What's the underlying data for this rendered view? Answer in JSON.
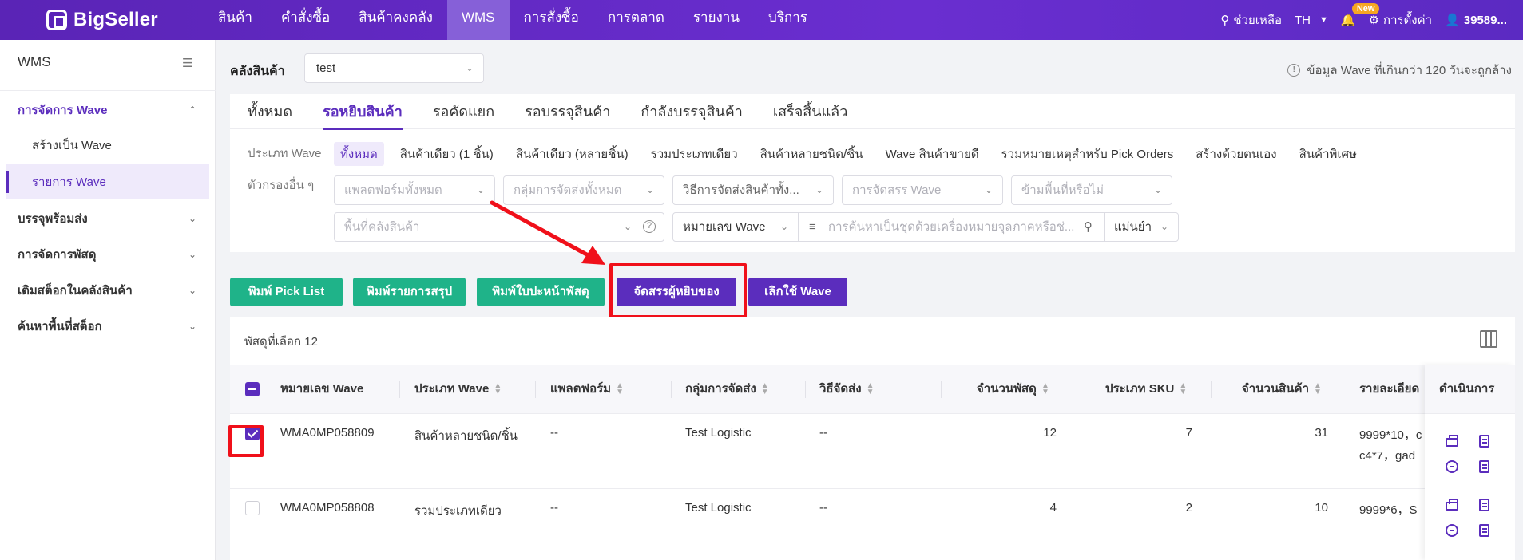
{
  "brand": {
    "name": "BigSeller"
  },
  "topnav": {
    "items": [
      "สินค้า",
      "คำสั่งซื้อ",
      "สินค้าคงคลัง",
      "WMS",
      "การสั่งซื้อ",
      "การตลาด",
      "รายงาน",
      "บริการ"
    ],
    "active_index": 3,
    "help": "ช่วยเหลือ",
    "lang": "TH",
    "new_badge": "New",
    "settings": "การตั้งค่า",
    "user": "39589..."
  },
  "sidebar": {
    "title": "WMS",
    "groups": [
      {
        "label": "การจัดการ Wave",
        "open": true
      },
      {
        "label": "บรรจุพร้อมส่ง"
      },
      {
        "label": "การจัดการพัสดุ"
      },
      {
        "label": "เติมสต็อกในคลังสินค้า"
      },
      {
        "label": "ค้นหาพื้นที่สต็อก"
      }
    ],
    "subitems": [
      "สร้างเป็น Wave",
      "รายการ Wave"
    ]
  },
  "warehouse": {
    "label": "คลังสินค้า",
    "value": "test",
    "notice": "ข้อมูล Wave ที่เกินกว่า 120 วันจะถูกล้าง"
  },
  "tabs": [
    "ทั้งหมด",
    "รอหยิบสินค้า",
    "รอคัดแยก",
    "รอบรรจุสินค้า",
    "กำลังบรรจุสินค้า",
    "เสร็จสิ้นแล้ว"
  ],
  "filters": {
    "wave_type_label": "ประเภท Wave",
    "wave_types": [
      "ทั้งหมด",
      "สินค้าเดียว (1 ชิ้น)",
      "สินค้าเดียว (หลายชิ้น)",
      "รวมประเภทเดียว",
      "สินค้าหลายชนิด/ชิ้น",
      "Wave สินค้าขายดี",
      "รวมหมายเหตุสำหรับ Pick Orders",
      "สร้างด้วยตนเอง",
      "สินค้าพิเศษ"
    ],
    "other_label": "ตัวกรองอื่น ๆ",
    "platform_ph": "แพลตฟอร์มทั้งหมด",
    "shipping_group_ph": "กลุ่มการจัดส่งทั้งหมด",
    "shipping_method_ph": "วิธีการจัดส่งสินค้าทั้ง...",
    "allocate_ph": "การจัดสรร Wave",
    "skip_area_ph": "ข้ามพื้นที่หรือไม่",
    "area_ph": "พื้นที่คลังสินค้า",
    "search_field": "หมายเลข Wave",
    "search_ph": "การค้นหาเป็นชุดด้วยเครื่องหมายจุลภาคหรือช่...",
    "match_mode": "แม่นยำ"
  },
  "actions": {
    "print_pick_list": "พิมพ์ Pick List",
    "print_summary": "พิมพ์รายการสรุป",
    "print_cover": "พิมพ์ใบปะหน้าพัสดุ",
    "assign_picker": "จัดสรรผู้หยิบของ",
    "cancel_wave": "เลิกใช้ Wave"
  },
  "table": {
    "selected_text": "พัสดุที่เลือก 12",
    "headers": {
      "wave_no": "หมายเลข Wave",
      "wave_type": "ประเภท Wave",
      "platform": "แพลตฟอร์ม",
      "shipping_group": "กลุ่มการจัดส่ง",
      "shipping_method": "วิธีจัดส่ง",
      "parcels": "จำนวนพัสดุ",
      "sku_types": "ประเภท SKU",
      "qty": "จำนวนสินค้า",
      "detail": "รายละเอียด",
      "ops": "ดำเนินการ"
    },
    "rows": [
      {
        "wave_no": "WMA0MP058809",
        "wave_type": "สินค้าหลายชนิด/ชิ้น",
        "platform": "--",
        "shipping_group": "Test Logistic",
        "shipping_method": "--",
        "parcels": "12",
        "sku_types": "7",
        "qty": "31",
        "detail_1": "9999*10，c",
        "detail_2": "c4*7，gad",
        "checked": true
      },
      {
        "wave_no": "WMA0MP058808",
        "wave_type": "รวมประเภทเดียว",
        "platform": "--",
        "shipping_group": "Test Logistic",
        "shipping_method": "--",
        "parcels": "4",
        "sku_types": "2",
        "qty": "10",
        "detail_1": "9999*6，S",
        "detail_2": "",
        "checked": false
      }
    ]
  },
  "colors": {
    "brand_purple": "#5b2dbd",
    "green": "#1fb389",
    "highlight_red": "#f0101a"
  }
}
